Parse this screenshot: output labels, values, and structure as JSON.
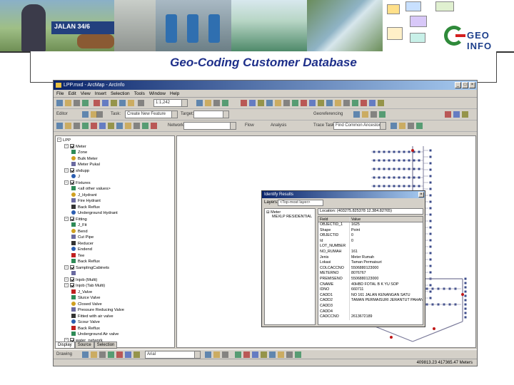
{
  "banner": {
    "street_sign": "JALAN 34/6",
    "logo_text": "GEO INFO"
  },
  "slide": {
    "title": "Geo-Coding Customer Database"
  },
  "app": {
    "window_title": "LPP.mxd - ArcMap - ArcInfo",
    "menus": [
      "File",
      "Edit",
      "View",
      "Insert",
      "Selection",
      "Tools",
      "Window",
      "Help"
    ],
    "scale": "1:1,242",
    "edit_label": "Editor",
    "task_label": "Task:",
    "task_value": "Create New Feature",
    "target_label": "Target:",
    "georef_label": "Georeferencing",
    "network_label": "Network",
    "flow_label": "Flow",
    "analysis_label": "Analysis",
    "trace_task_label": "Trace Task:",
    "trace_task_value": "Find Common Ancestors",
    "font_name": "Arial",
    "drawing_label": "Drawing",
    "status_coords": "409813.23 417365.47 Meters"
  },
  "toc": {
    "items": [
      {
        "label": "LPP",
        "level": 0,
        "type": "root"
      },
      {
        "label": "Meter",
        "level": 1,
        "type": "layer"
      },
      {
        "label": "Zone",
        "level": 2,
        "type": "legend"
      },
      {
        "label": "Bulk Meter",
        "level": 2,
        "type": "legend"
      },
      {
        "label": "Meter Pukal",
        "level": 2,
        "type": "legend"
      },
      {
        "label": "shdupp",
        "level": 1,
        "type": "layer"
      },
      {
        "label": "J",
        "level": 2,
        "type": "legend"
      },
      {
        "label": "Fixtures",
        "level": 1,
        "type": "layer"
      },
      {
        "label": "<all other values>",
        "level": 2,
        "type": "legend"
      },
      {
        "label": "J_Hydrant",
        "level": 2,
        "type": "legend"
      },
      {
        "label": "Fire Hydrant",
        "level": 2,
        "type": "legend"
      },
      {
        "label": "Back Reflux",
        "level": 2,
        "type": "legend"
      },
      {
        "label": "Underground Hydrant",
        "level": 2,
        "type": "legend"
      },
      {
        "label": "Fitting",
        "level": 1,
        "type": "layer"
      },
      {
        "label": "J_Fit",
        "level": 2,
        "type": "legend"
      },
      {
        "label": "Bend",
        "level": 2,
        "type": "legend"
      },
      {
        "label": "Cut Pipe",
        "level": 2,
        "type": "legend"
      },
      {
        "label": "Reducer",
        "level": 2,
        "type": "legend"
      },
      {
        "label": "Endend",
        "level": 2,
        "type": "legend"
      },
      {
        "label": "Tee",
        "level": 2,
        "type": "legend"
      },
      {
        "label": "Back Reflux",
        "level": 2,
        "type": "legend"
      },
      {
        "label": "SamplingCabinets",
        "level": 1,
        "type": "layer"
      },
      {
        "label": "",
        "level": 2,
        "type": "legend"
      },
      {
        "label": "Injob (Multi)",
        "level": 1,
        "type": "layer"
      },
      {
        "label": "Injob (Tab Multi)",
        "level": 1,
        "type": "layer"
      },
      {
        "label": "J_Valve",
        "level": 2,
        "type": "legend"
      },
      {
        "label": "Sluice Valve",
        "level": 2,
        "type": "legend"
      },
      {
        "label": "Closed Valve",
        "level": 2,
        "type": "legend"
      },
      {
        "label": "Pressure Reducing Valve",
        "level": 2,
        "type": "legend"
      },
      {
        "label": "Fitted with air valve",
        "level": 2,
        "type": "legend"
      },
      {
        "label": "Scour Valve",
        "level": 2,
        "type": "legend"
      },
      {
        "label": "Back Reflux",
        "level": 2,
        "type": "legend"
      },
      {
        "label": "Underground Air valve",
        "level": 2,
        "type": "legend"
      },
      {
        "label": "water_network",
        "level": 1,
        "type": "layer"
      }
    ],
    "tabs": [
      "Display",
      "Source",
      "Selection"
    ]
  },
  "identify": {
    "title": "Identify Results",
    "layers_label": "Layers:",
    "layers_value": "<Top-most layer>",
    "tree_root": "Meter",
    "tree_child": "MEXLP RESIDENTIAL",
    "location_label": "Location:",
    "location_value": "(403275.825378  12.384.82765)",
    "col_field": "Field",
    "col_value": "Value",
    "rows": [
      {
        "field": "OBJECTID_1",
        "value": "1625"
      },
      {
        "field": "Shape",
        "value": "Point"
      },
      {
        "field": "OBJECTID",
        "value": "0"
      },
      {
        "field": "Id",
        "value": "0"
      },
      {
        "field": "LOT_NUMBER",
        "value": ""
      },
      {
        "field": "NO_RUMAH",
        "value": "161"
      },
      {
        "field": "Jenis",
        "value": "Meter Rumah"
      },
      {
        "field": "Lokasi",
        "value": "Taman Permaisuri"
      },
      {
        "field": "COLCACCNO",
        "value": "5506880123000"
      },
      {
        "field": "METERNO",
        "value": "8076767"
      },
      {
        "field": "PREMISENO",
        "value": "5506880123000"
      },
      {
        "field": "CNAME",
        "value": "40HBD FOTAL B K YU SOP"
      },
      {
        "field": "IDNO",
        "value": "660711"
      },
      {
        "field": "CADD1",
        "value": "NO 161 JALAN KENANGAN SATU"
      },
      {
        "field": "CADD2",
        "value": "TAMAN PERMAISURI JERANTUT PAHANG"
      },
      {
        "field": "CADD3",
        "value": ""
      },
      {
        "field": "CADD4",
        "value": ""
      },
      {
        "field": "CADCCNO",
        "value": "2613672189"
      }
    ]
  },
  "colors": {
    "title_blue": "#1e2f8a",
    "win_gray": "#d4d0c8",
    "titlebar_blue": "#0a246a",
    "pipe_gray": "#7a7a9a",
    "meter_red": "#c01818"
  }
}
